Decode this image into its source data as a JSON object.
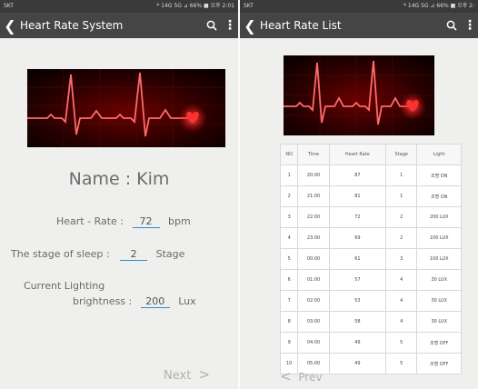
{
  "left": {
    "status": {
      "carrier": "SKT",
      "right": "* 14G 5G ⊿ 66% ■ 오후 2:01"
    },
    "title": "Heart Rate System",
    "name_label": "Name : Kim",
    "heart_rate_label": "Heart - Rate :",
    "heart_rate_value": "72",
    "heart_rate_unit": "bpm",
    "sleep_label": "The stage of sleep :",
    "sleep_value": "2",
    "sleep_unit": "Stage",
    "lighting_label_1": "Current Lighting",
    "lighting_label_2": "brightness :",
    "lighting_value": "200",
    "lighting_unit": "Lux",
    "next_label": "Next",
    "next_arrow": ">"
  },
  "right": {
    "status": {
      "carrier": "SKT",
      "right": "* 14G 5G ⊿ 66% ■ 오후 2:"
    },
    "title": "Heart Rate List",
    "prev_arrow": "<",
    "prev_label": "Prev",
    "table": {
      "headers": [
        "NO",
        "Time",
        "Heart Rate",
        "Stage",
        "Light"
      ],
      "rows": [
        [
          "1",
          "20:00",
          "87",
          "1",
          "조명 ON"
        ],
        [
          "2",
          "21:00",
          "81",
          "1",
          "조명 ON"
        ],
        [
          "3",
          "22:00",
          "72",
          "2",
          "200 LUX"
        ],
        [
          "4",
          "23:00",
          "69",
          "2",
          "100 LUX"
        ],
        [
          "5",
          "00:00",
          "61",
          "3",
          "100 LUX"
        ],
        [
          "6",
          "01:00",
          "57",
          "4",
          "30 LUX"
        ],
        [
          "7",
          "02:00",
          "53",
          "4",
          "30 LUX"
        ],
        [
          "8",
          "03:00",
          "58",
          "4",
          "30 LUX"
        ],
        [
          "9",
          "04:00",
          "49",
          "5",
          "조명 OFF"
        ],
        [
          "10",
          "05:00",
          "49",
          "5",
          "조명 OFF"
        ]
      ]
    }
  },
  "icons": {
    "back": "chevron-left-icon",
    "search": "search-icon",
    "menu": "overflow-menu-icon",
    "image": "heartbeat-ecg-image"
  },
  "colors": {
    "appbar": "#454545",
    "underline": "#2a8fcf",
    "ecg_glow": "#ff3030"
  }
}
